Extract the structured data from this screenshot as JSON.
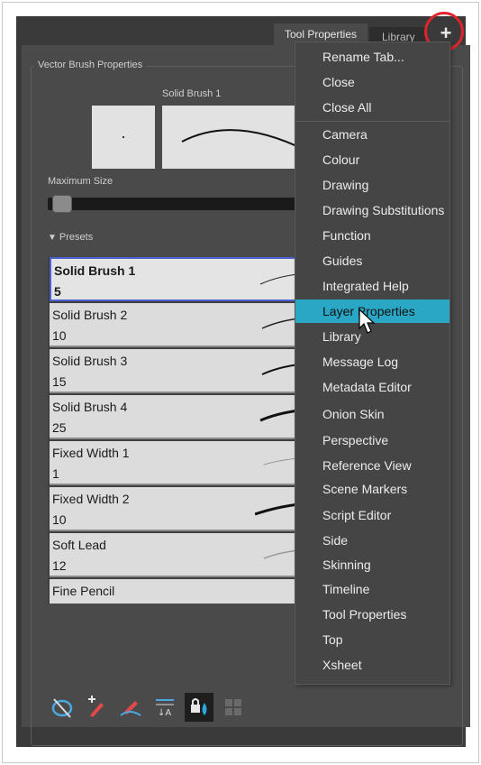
{
  "tabs": {
    "tool_properties": "Tool Properties",
    "library": "Library",
    "add_symbol": "+"
  },
  "vector_brush": {
    "group_title": "Vector Brush Properties",
    "brush_name": "Solid Brush 1",
    "max_size_label": "Maximum Size",
    "max_size_level_fraction": 0.03,
    "presets_label": "Presets"
  },
  "presets": [
    {
      "name": "Solid Brush 1",
      "size": "5"
    },
    {
      "name": "Solid Brush 2",
      "size": "10"
    },
    {
      "name": "Solid Brush 3",
      "size": "15"
    },
    {
      "name": "Solid Brush 4",
      "size": "25"
    },
    {
      "name": "Fixed Width 1",
      "size": "1"
    },
    {
      "name": "Fixed Width 2",
      "size": "10"
    },
    {
      "name": "Soft Lead",
      "size": "12"
    },
    {
      "name": "Fine Pencil",
      "size": ""
    }
  ],
  "menu": {
    "items": [
      "Rename Tab...",
      "Close",
      "Close All",
      "Camera",
      "Colour",
      "Drawing",
      "Drawing Substitutions",
      "Function",
      "Guides",
      "Integrated Help",
      "Layer Properties",
      "Library",
      "Message Log",
      "Metadata Editor",
      "Onion Skin",
      "Perspective",
      "Reference View",
      "Scene Markers",
      "Script Editor",
      "Side",
      "Skinning",
      "Timeline",
      "Tool Properties",
      "Top",
      "Xsheet"
    ],
    "highlighted": "Layer Properties"
  },
  "toolbar_icons": [
    "ellipse-tool-icon",
    "brush-add-icon",
    "brush-edit-icon",
    "text-align-icon",
    "lock-colour-icon",
    "grid-icon"
  ],
  "colors": {
    "highlight": "#2aa7c4",
    "selection_border": "#4d5fd1",
    "callout_circle": "#e0242b"
  }
}
